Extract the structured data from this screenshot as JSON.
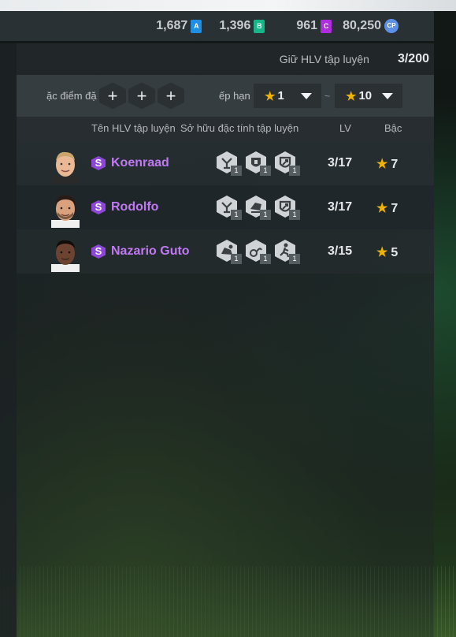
{
  "currencies": [
    {
      "value": "1,687",
      "tag": "A",
      "color": "#1f8fe6"
    },
    {
      "value": "1,396",
      "tag": "B",
      "color": "#17b58a"
    },
    {
      "value": "961",
      "tag": "C",
      "color": "#b02ce0"
    },
    {
      "value": "80,250",
      "tag": "CP",
      "color": "#5c8fe6"
    }
  ],
  "keep": {
    "label": "Giữ HLV tập luyện",
    "value": "3/200"
  },
  "filters": {
    "traits_label": "ặc điểm đặc",
    "rank_label": "ếp hạng",
    "rank_min": "1",
    "rank_max": "10",
    "separator": "~"
  },
  "columns": {
    "name": "Tên HLV tập luyện",
    "traits": "Sở hữu đặc tính tập luyện",
    "lv": "LV",
    "rank": "Bậc"
  },
  "coaches": [
    {
      "grade": "S",
      "name": "Koenraad",
      "traits": [
        {
          "icon": "whistle-coach-icon",
          "level": "1"
        },
        {
          "icon": "shield-lock-icon",
          "level": "1"
        },
        {
          "icon": "shield-arrow-icon",
          "level": "1"
        }
      ],
      "lv": "3/17",
      "rank": "7",
      "hair": "#c9a46b",
      "skin": "#e9b996"
    },
    {
      "grade": "S",
      "name": "Rodolfo",
      "traits": [
        {
          "icon": "whistle-coach-icon",
          "level": "1"
        },
        {
          "icon": "boot-tackle-icon",
          "level": "1"
        },
        {
          "icon": "shield-arrow-icon",
          "level": "1"
        }
      ],
      "lv": "3/17",
      "rank": "7",
      "hair": "#2a1c14",
      "skin": "#d9a27d"
    },
    {
      "grade": "S",
      "name": "Nazario Guto",
      "traits": [
        {
          "icon": "boot-kick-icon",
          "level": "1"
        },
        {
          "icon": "dribble-icon",
          "level": "1"
        },
        {
          "icon": "runner-icon",
          "level": "1"
        }
      ],
      "lv": "3/15",
      "rank": "5",
      "hair": "#120c09",
      "skin": "#6b4330"
    }
  ]
}
